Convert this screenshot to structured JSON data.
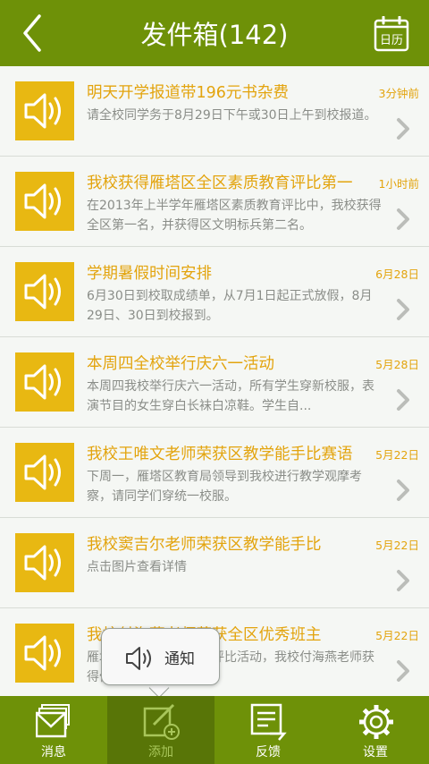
{
  "header": {
    "title": "发件箱(142)",
    "calendar_label": "日历"
  },
  "items": [
    {
      "title": "明天开学报道带196元书杂费",
      "time": "3分钟前",
      "desc": "请全校同学务于8月29日下午或30日上午到校报道。"
    },
    {
      "title": "我校获得雁塔区全区素质教育评比第一",
      "time": "1小时前",
      "desc": "在2013年上半学年雁塔区素质教育评比中，我校获得全区第一名，并获得区文明标兵第二名。"
    },
    {
      "title": "学期暑假时间安排",
      "time": "6月28日",
      "desc": "6月30日到校取成绩单，从7月1日起正式放假，8月29日、30日到校报到。"
    },
    {
      "title": "本周四全校举行庆六一活动",
      "time": "5月28日",
      "desc": "本周四我校举行庆六一活动，所有学生穿新校服，表演节目的女生穿白长袜白凉鞋。学生自..."
    },
    {
      "title": "我校王唯文老师荣获区教学能手比赛语",
      "time": "5月22日",
      "desc": "下周一，雁塔区教育局领导到我校进行教学观摩考察，请同学们穿统一校服。"
    },
    {
      "title": "我校窦吉尔老师荣获区教学能手比",
      "time": "5月22日",
      "desc": "点击图片查看详情"
    },
    {
      "title": "我校付海燕老师荣获全区优秀班主",
      "time": "5月22日",
      "desc": "雁塔区举行优秀班主任评比活动，我校付海燕老师获得优秀班主任称号。"
    }
  ],
  "popup": {
    "label": "通知"
  },
  "tabs": [
    {
      "label": "消息",
      "icon": "mail-stack-icon"
    },
    {
      "label": "添加",
      "icon": "compose-add-icon"
    },
    {
      "label": "反馈",
      "icon": "feedback-doc-icon"
    },
    {
      "label": "设置",
      "icon": "gear-icon"
    }
  ],
  "colors": {
    "brand": "#6e9108",
    "accent": "#e3a40e",
    "thumb": "#e8b812"
  }
}
